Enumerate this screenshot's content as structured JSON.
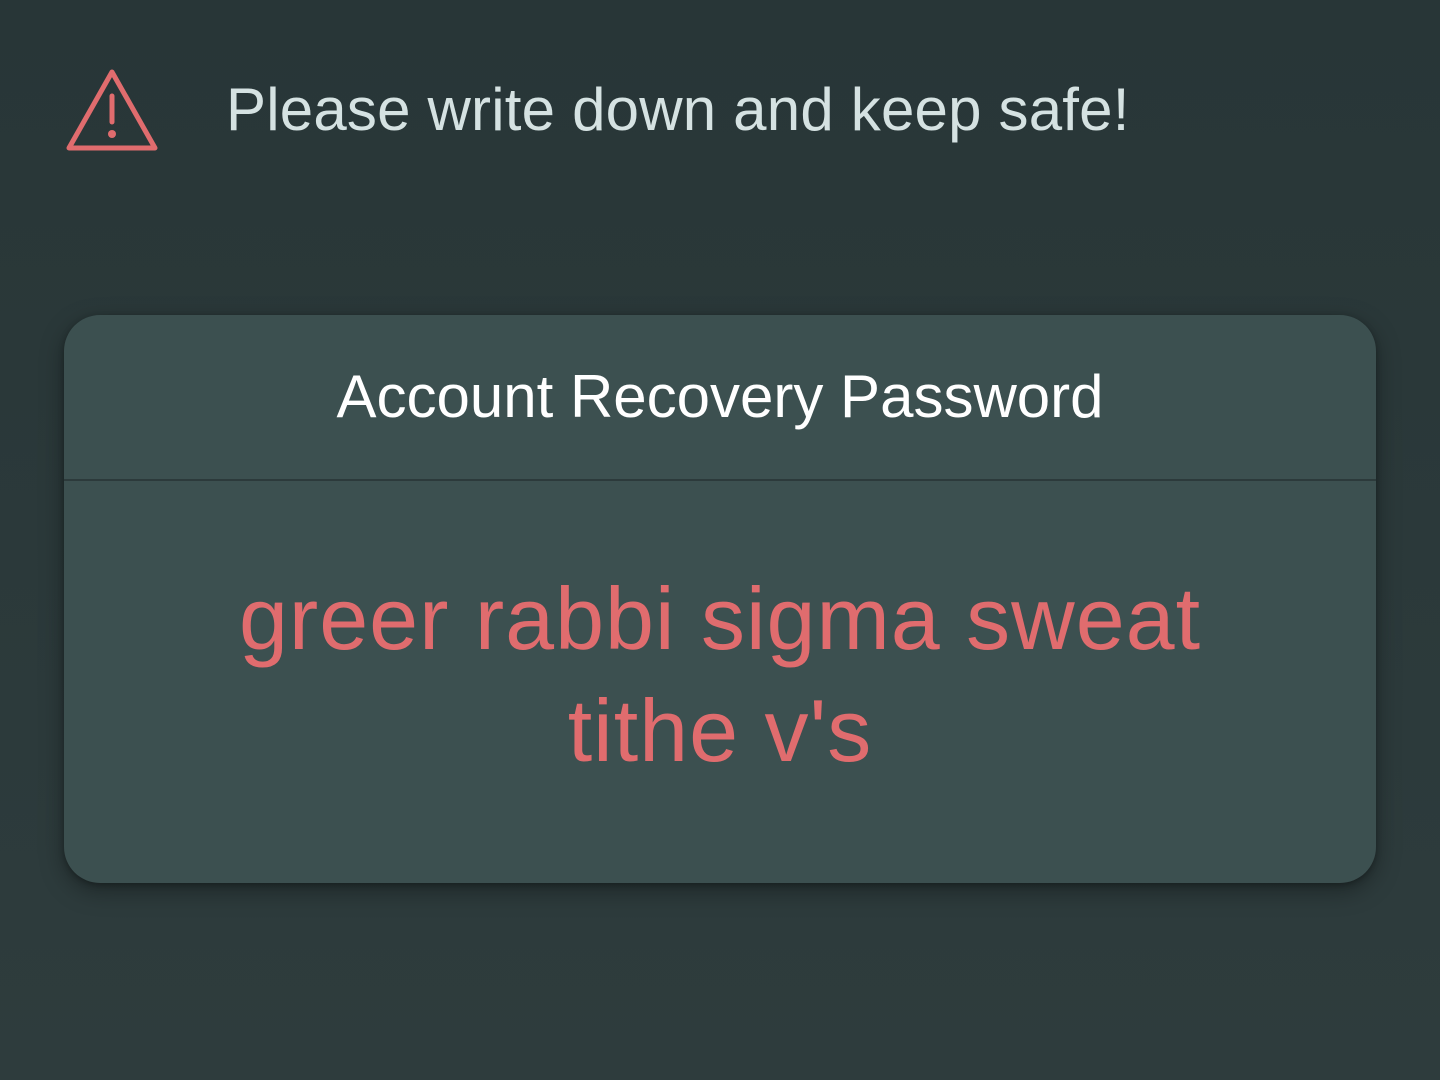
{
  "warning": {
    "icon": "warning-triangle-icon",
    "text": "Please write down and keep safe!"
  },
  "card": {
    "title": "Account Recovery Password",
    "phrase": "greer rabbi sigma sweat tithe v's"
  },
  "colors": {
    "background": "#2b3939",
    "card": "#3c5050",
    "accent": "#e06c6e",
    "warning_text": "#d5e2e2",
    "title_text": "#ffffff"
  }
}
